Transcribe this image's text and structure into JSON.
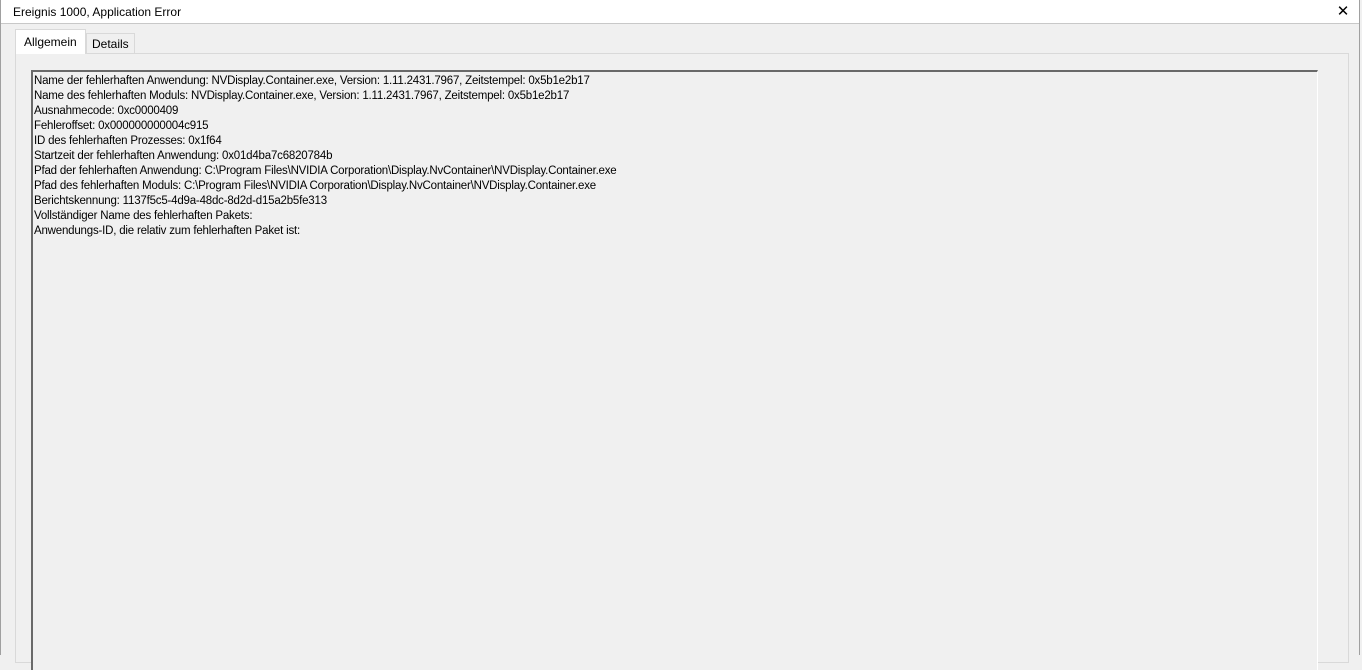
{
  "window": {
    "title": "Ereignis 1000, Application Error",
    "close_label": "✕"
  },
  "tabs": [
    {
      "label": "Allgemein",
      "active": true
    },
    {
      "label": "Details",
      "active": false
    }
  ],
  "description_lines": [
    "Name der fehlerhaften Anwendung: NVDisplay.Container.exe, Version: 1.11.2431.7967, Zeitstempel: 0x5b1e2b17",
    "Name des fehlerhaften Moduls: NVDisplay.Container.exe, Version: 1.11.2431.7967, Zeitstempel: 0x5b1e2b17",
    "Ausnahmecode: 0xc0000409",
    "Fehleroffset: 0x000000000004c915",
    "ID des fehlerhaften Prozesses: 0x1f64",
    "Startzeit der fehlerhaften Anwendung: 0x01d4ba7c6820784b",
    "Pfad der fehlerhaften Anwendung: C:\\Program Files\\NVIDIA Corporation\\Display.NvContainer\\NVDisplay.Container.exe",
    "Pfad des fehlerhaften Moduls: C:\\Program Files\\NVIDIA Corporation\\Display.NvContainer\\NVDisplay.Container.exe",
    "Berichtskennung: 1137f5c5-4d9a-48dc-8d2d-d15a2b5fe313",
    "Vollständiger Name des fehlerhaften Pakets:",
    "Anwendungs-ID, die relativ zum fehlerhaften Paket ist:"
  ]
}
